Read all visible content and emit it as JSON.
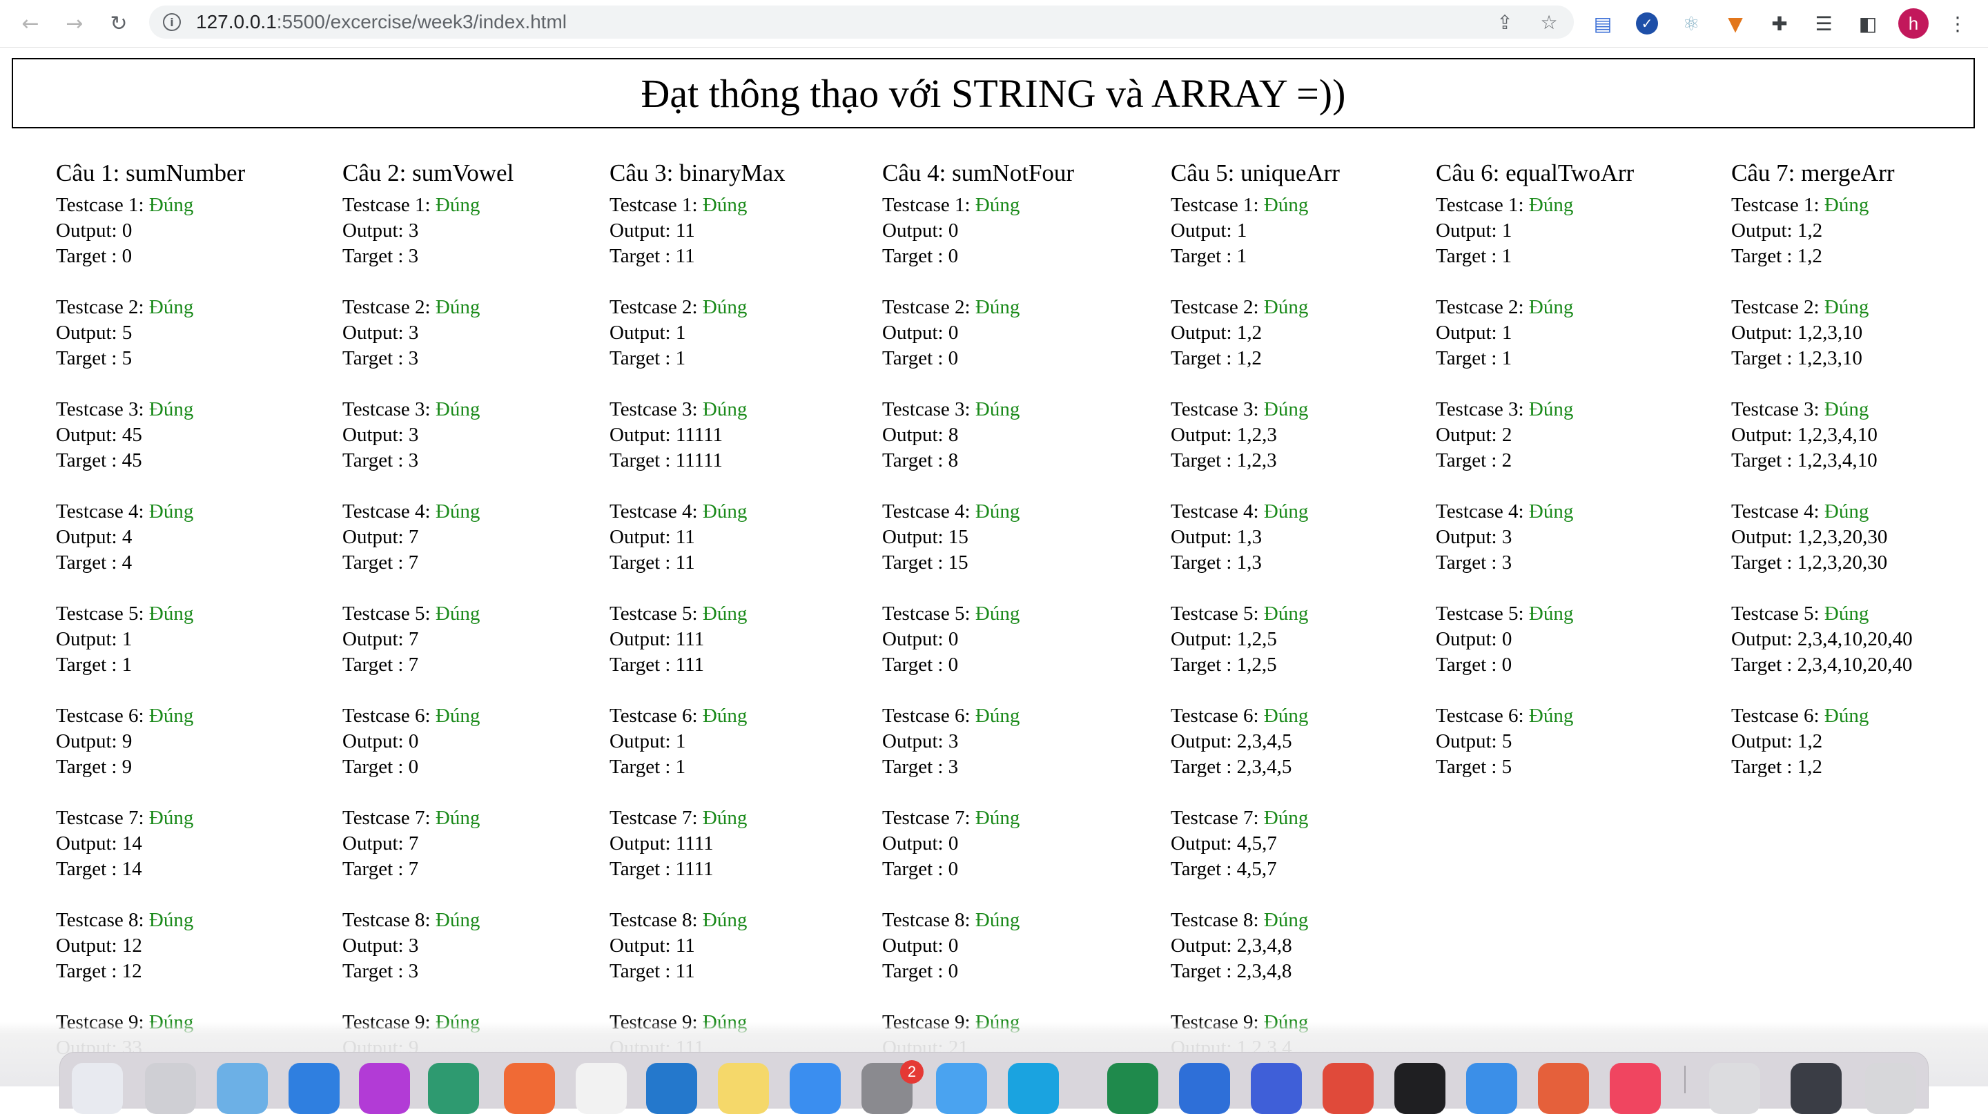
{
  "browser": {
    "url_host": "127.0.0.1",
    "url_rest": ":5500/excercise/week3/index.html",
    "profile_initial": "h",
    "back_icon": "back-arrow-icon",
    "forward_icon": "forward-arrow-icon",
    "reload_icon": "reload-icon",
    "dock_badge": "2"
  },
  "page": {
    "title": "Đạt thông thạo với STRING và ARRAY =))",
    "status_color": "#1a8a1a"
  },
  "columns": [
    {
      "title": "Câu 1: sumNumber",
      "cases": [
        {
          "label": "Testcase 1:",
          "status": "Đúng",
          "output": "Output: 0",
          "target": "Target : 0"
        },
        {
          "label": "Testcase 2:",
          "status": "Đúng",
          "output": "Output: 5",
          "target": "Target : 5"
        },
        {
          "label": "Testcase 3:",
          "status": "Đúng",
          "output": "Output: 45",
          "target": "Target : 45"
        },
        {
          "label": "Testcase 4:",
          "status": "Đúng",
          "output": "Output: 4",
          "target": "Target : 4"
        },
        {
          "label": "Testcase 5:",
          "status": "Đúng",
          "output": "Output: 1",
          "target": "Target : 1"
        },
        {
          "label": "Testcase 6:",
          "status": "Đúng",
          "output": "Output: 9",
          "target": "Target : 9"
        },
        {
          "label": "Testcase 7:",
          "status": "Đúng",
          "output": "Output: 14",
          "target": "Target : 14"
        },
        {
          "label": "Testcase 8:",
          "status": "Đúng",
          "output": "Output: 12",
          "target": "Target : 12"
        },
        {
          "label": "Testcase 9:",
          "status": "Đúng",
          "output": "Output: 33",
          "target": ""
        }
      ]
    },
    {
      "title": "Câu 2: sumVowel",
      "cases": [
        {
          "label": "Testcase 1:",
          "status": "Đúng",
          "output": "Output: 3",
          "target": "Target : 3"
        },
        {
          "label": "Testcase 2:",
          "status": "Đúng",
          "output": "Output: 3",
          "target": "Target : 3"
        },
        {
          "label": "Testcase 3:",
          "status": "Đúng",
          "output": "Output: 3",
          "target": "Target : 3"
        },
        {
          "label": "Testcase 4:",
          "status": "Đúng",
          "output": "Output: 7",
          "target": "Target : 7"
        },
        {
          "label": "Testcase 5:",
          "status": "Đúng",
          "output": "Output: 7",
          "target": "Target : 7"
        },
        {
          "label": "Testcase 6:",
          "status": "Đúng",
          "output": "Output: 0",
          "target": "Target : 0"
        },
        {
          "label": "Testcase 7:",
          "status": "Đúng",
          "output": "Output: 7",
          "target": "Target : 7"
        },
        {
          "label": "Testcase 8:",
          "status": "Đúng",
          "output": "Output: 3",
          "target": "Target : 3"
        },
        {
          "label": "Testcase 9:",
          "status": "Đúng",
          "output": "Output: 9",
          "target": ""
        }
      ]
    },
    {
      "title": "Câu 3: binaryMax",
      "cases": [
        {
          "label": "Testcase 1:",
          "status": "Đúng",
          "output": "Output: 11",
          "target": "Target : 11"
        },
        {
          "label": "Testcase 2:",
          "status": "Đúng",
          "output": "Output: 1",
          "target": "Target : 1"
        },
        {
          "label": "Testcase 3:",
          "status": "Đúng",
          "output": "Output: 11111",
          "target": "Target : 11111"
        },
        {
          "label": "Testcase 4:",
          "status": "Đúng",
          "output": "Output: 11",
          "target": "Target : 11"
        },
        {
          "label": "Testcase 5:",
          "status": "Đúng",
          "output": "Output: 111",
          "target": "Target : 111"
        },
        {
          "label": "Testcase 6:",
          "status": "Đúng",
          "output": "Output: 1",
          "target": "Target : 1"
        },
        {
          "label": "Testcase 7:",
          "status": "Đúng",
          "output": "Output: 1111",
          "target": "Target : 1111"
        },
        {
          "label": "Testcase 8:",
          "status": "Đúng",
          "output": "Output: 11",
          "target": "Target : 11"
        },
        {
          "label": "Testcase 9:",
          "status": "Đúng",
          "output": "Output: 111",
          "target": ""
        }
      ]
    },
    {
      "title": "Câu 4: sumNotFour",
      "cases": [
        {
          "label": "Testcase 1:",
          "status": "Đúng",
          "output": "Output: 0",
          "target": "Target : 0"
        },
        {
          "label": "Testcase 2:",
          "status": "Đúng",
          "output": "Output: 0",
          "target": "Target : 0"
        },
        {
          "label": "Testcase 3:",
          "status": "Đúng",
          "output": "Output: 8",
          "target": "Target : 8"
        },
        {
          "label": "Testcase 4:",
          "status": "Đúng",
          "output": "Output: 15",
          "target": "Target : 15"
        },
        {
          "label": "Testcase 5:",
          "status": "Đúng",
          "output": "Output: 0",
          "target": "Target : 0"
        },
        {
          "label": "Testcase 6:",
          "status": "Đúng",
          "output": "Output: 3",
          "target": "Target : 3"
        },
        {
          "label": "Testcase 7:",
          "status": "Đúng",
          "output": "Output: 0",
          "target": "Target : 0"
        },
        {
          "label": "Testcase 8:",
          "status": "Đúng",
          "output": "Output: 0",
          "target": "Target : 0"
        },
        {
          "label": "Testcase 9:",
          "status": "Đúng",
          "output": "Output: 21",
          "target": ""
        }
      ]
    },
    {
      "title": "Câu 5: uniqueArr",
      "cases": [
        {
          "label": "Testcase 1:",
          "status": "Đúng",
          "output": "Output: 1",
          "target": "Target : 1"
        },
        {
          "label": "Testcase 2:",
          "status": "Đúng",
          "output": "Output: 1,2",
          "target": "Target : 1,2"
        },
        {
          "label": "Testcase 3:",
          "status": "Đúng",
          "output": "Output: 1,2,3",
          "target": "Target : 1,2,3"
        },
        {
          "label": "Testcase 4:",
          "status": "Đúng",
          "output": "Output: 1,3",
          "target": "Target : 1,3"
        },
        {
          "label": "Testcase 5:",
          "status": "Đúng",
          "output": "Output: 1,2,5",
          "target": "Target : 1,2,5"
        },
        {
          "label": "Testcase 6:",
          "status": "Đúng",
          "output": "Output: 2,3,4,5",
          "target": "Target : 2,3,4,5"
        },
        {
          "label": "Testcase 7:",
          "status": "Đúng",
          "output": "Output: 4,5,7",
          "target": "Target : 4,5,7"
        },
        {
          "label": "Testcase 8:",
          "status": "Đúng",
          "output": "Output: 2,3,4,8",
          "target": "Target : 2,3,4,8"
        },
        {
          "label": "Testcase 9:",
          "status": "Đúng",
          "output": "Output: 1,2,3,4",
          "target": ""
        }
      ]
    },
    {
      "title": "Câu 6: equalTwoArr",
      "cases": [
        {
          "label": "Testcase 1:",
          "status": "Đúng",
          "output": "Output: 1",
          "target": "Target : 1"
        },
        {
          "label": "Testcase 2:",
          "status": "Đúng",
          "output": "Output: 1",
          "target": "Target : 1"
        },
        {
          "label": "Testcase 3:",
          "status": "Đúng",
          "output": "Output: 2",
          "target": "Target : 2"
        },
        {
          "label": "Testcase 4:",
          "status": "Đúng",
          "output": "Output: 3",
          "target": "Target : 3"
        },
        {
          "label": "Testcase 5:",
          "status": "Đúng",
          "output": "Output: 0",
          "target": "Target : 0"
        },
        {
          "label": "Testcase 6:",
          "status": "Đúng",
          "output": "Output: 5",
          "target": "Target : 5"
        }
      ]
    },
    {
      "title": "Câu 7: mergeArr",
      "cases": [
        {
          "label": "Testcase 1:",
          "status": "Đúng",
          "output": "Output: 1,2",
          "target": "Target : 1,2"
        },
        {
          "label": "Testcase 2:",
          "status": "Đúng",
          "output": "Output: 1,2,3,10",
          "target": "Target : 1,2,3,10"
        },
        {
          "label": "Testcase 3:",
          "status": "Đúng",
          "output": "Output: 1,2,3,4,10",
          "target": "Target : 1,2,3,4,10"
        },
        {
          "label": "Testcase 4:",
          "status": "Đúng",
          "output": "Output: 1,2,3,20,30",
          "target": "Target : 1,2,3,20,30"
        },
        {
          "label": "Testcase 5:",
          "status": "Đúng",
          "output": "Output: 2,3,4,10,20,40",
          "target": "Target : 2,3,4,10,20,40"
        },
        {
          "label": "Testcase 6:",
          "status": "Đúng",
          "output": "Output: 1,2",
          "target": "Target : 1,2"
        }
      ]
    }
  ]
}
